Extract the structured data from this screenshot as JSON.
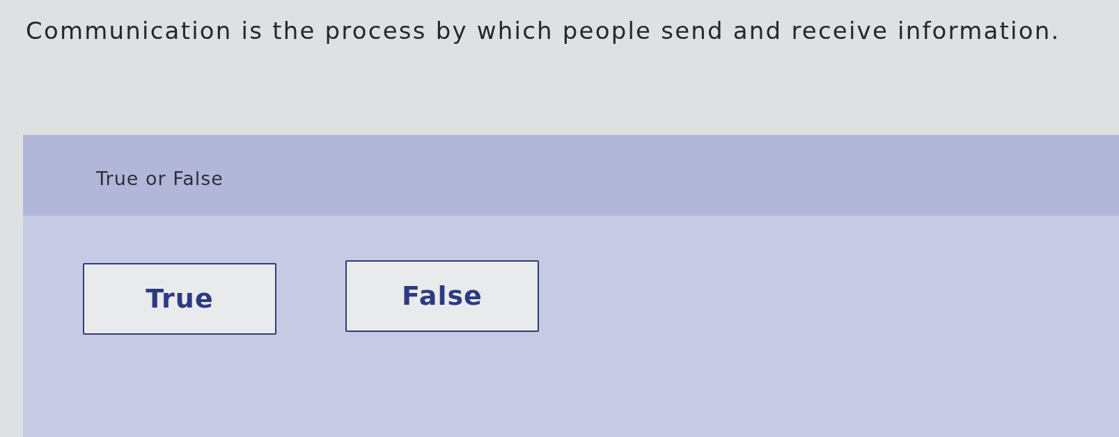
{
  "question": "Communication is the process by which people send and receive information.",
  "panel": {
    "header": "True or False",
    "options": [
      {
        "label": "True",
        "selected": false
      },
      {
        "label": "False",
        "selected": false
      }
    ]
  }
}
